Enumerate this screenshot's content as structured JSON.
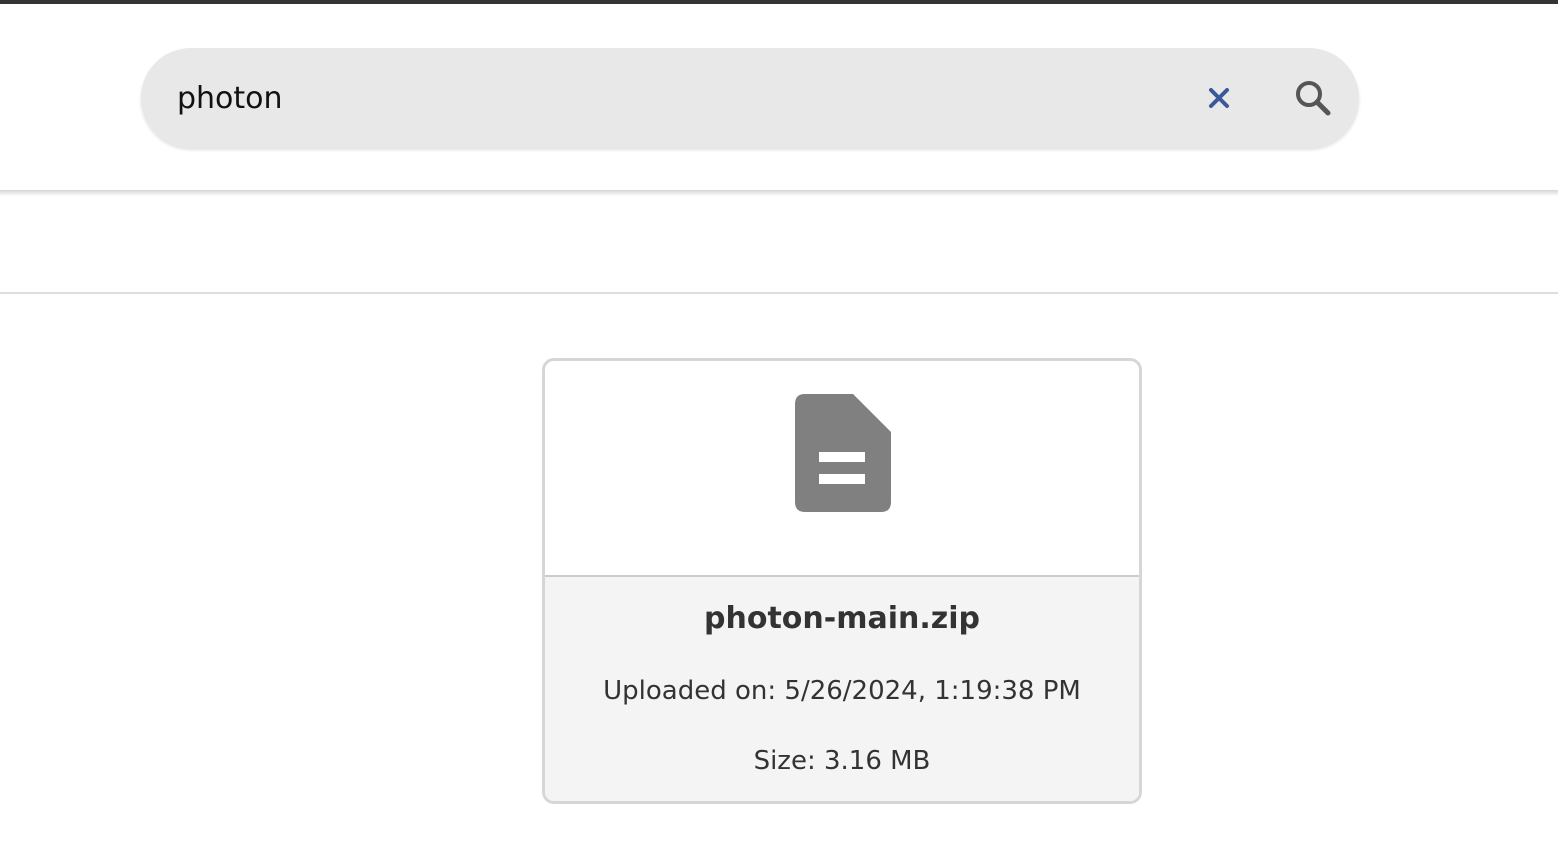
{
  "search": {
    "value": "photon",
    "clear_icon": "close-icon",
    "search_icon": "search-icon"
  },
  "colors": {
    "top_strip": "#333333",
    "search_bg": "#e8e8e8",
    "clear_icon": "#3b5998",
    "search_icon": "#555555",
    "file_icon": "#808080",
    "card_info_bg": "#f4f4f4",
    "text": "#333333"
  },
  "results": [
    {
      "icon": "document-icon",
      "name": "photon-main.zip",
      "uploaded": "Uploaded on: 5/26/2024, 1:19:38 PM",
      "size": "Size: 3.16 MB"
    }
  ]
}
